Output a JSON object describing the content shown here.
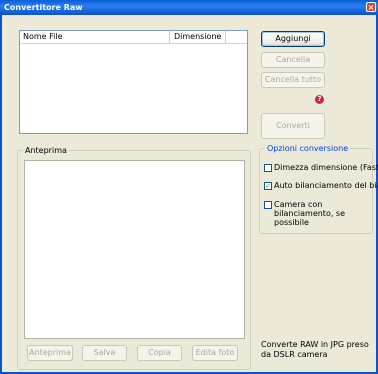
{
  "window": {
    "title": "Convertitore Raw",
    "close_symbol": "×"
  },
  "file_list": {
    "columns": [
      "Nome File",
      "Dimensione"
    ]
  },
  "actions": {
    "add": "Aggiungi",
    "delete": "Cancella",
    "delete_all": "Cancella tutto",
    "help": "?",
    "convert": "Converti"
  },
  "preview": {
    "title": "Anteprima",
    "buttons": {
      "preview": "Anteprima",
      "save": "Salva",
      "copy": "Copia",
      "edit": "Edita foto"
    }
  },
  "options": {
    "title": "Opzioni conversione",
    "halve_size": {
      "label": "Dimezza dimensione (Faste",
      "checked": false
    },
    "auto_wb": {
      "label": "Auto bilanciamento del bia",
      "checked": true
    },
    "camera_wb": {
      "label": "Camera con bilanciamento, se possibile",
      "checked": false
    }
  },
  "info": "Converte RAW in JPG preso da DSLR camera"
}
